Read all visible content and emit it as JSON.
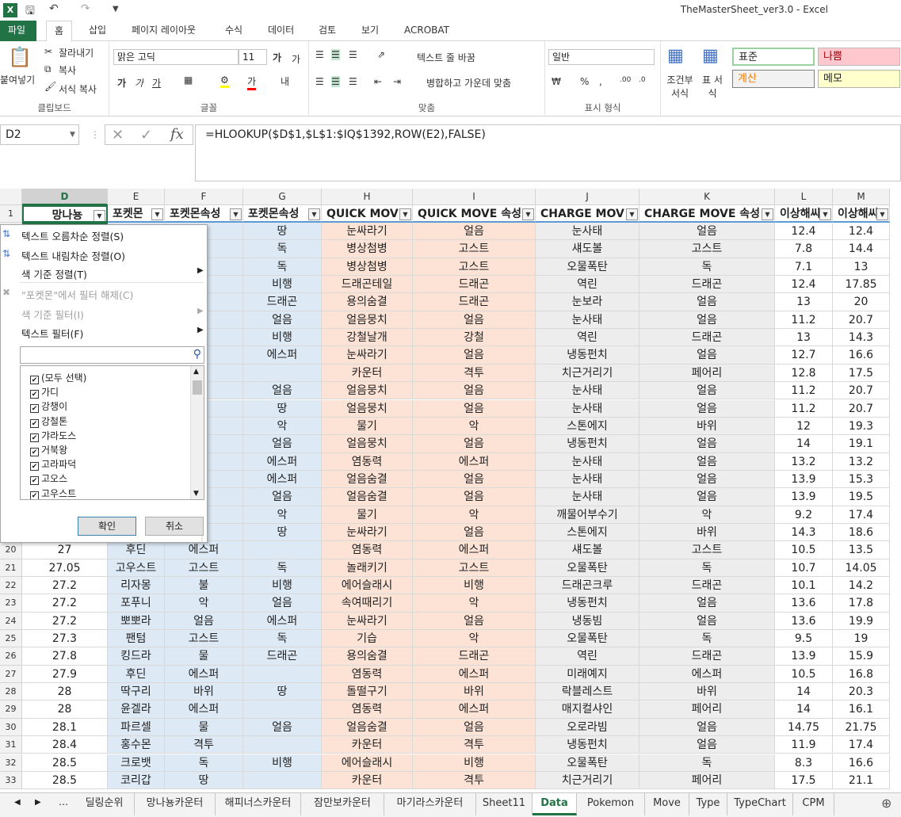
{
  "window": {
    "title": "TheMasterSheet_ver3.0 - Excel",
    "logo": "X"
  },
  "ribbon_tabs": [
    "파일",
    "홈",
    "삽입",
    "페이지 레이아웃",
    "수식",
    "데이터",
    "검토",
    "보기",
    "ACROBAT"
  ],
  "ribbon": {
    "clipboard": {
      "paste": "붙여넣기",
      "cut": "잘라내기",
      "copy": "복사",
      "format_painter": "서식 복사",
      "label": "클립보드"
    },
    "font": {
      "family": "맑은 고딕",
      "size": "11",
      "label": "글꼴"
    },
    "alignment": {
      "wrap": "텍스트 줄 바꿈",
      "merge": "병합하고 가운데 맞춤",
      "label": "맞춤"
    },
    "number": {
      "format": "일반",
      "label": "표시 형식"
    },
    "styles": {
      "cond_format": "조건부 서식",
      "table_format": "표 서식",
      "normal": "표준",
      "bad": "나쁨",
      "calc": "계산",
      "memo": "메모"
    }
  },
  "formula_bar": {
    "name_box": "D2",
    "formula": "=HLOOKUP($D$1,$L$1:$IQ$1392,ROW(E2),FALSE)"
  },
  "columns": [
    {
      "letter": "D",
      "header": "망나뇽",
      "w": 108
    },
    {
      "letter": "E",
      "header": "포켓몬",
      "w": 72
    },
    {
      "letter": "F",
      "header": "포켓몬속성",
      "w": 99
    },
    {
      "letter": "G",
      "header": "포켓몬속성",
      "w": 99
    },
    {
      "letter": "H",
      "header": "QUICK MOV",
      "w": 115
    },
    {
      "letter": "I",
      "header": "QUICK MOVE 속성",
      "w": 155
    },
    {
      "letter": "J",
      "header": "CHARGE MOV",
      "w": 131
    },
    {
      "letter": "K",
      "header": "CHARGE MOVE 속성",
      "w": 171
    },
    {
      "letter": "L",
      "header": "이상해씨",
      "w": 73
    },
    {
      "letter": "M",
      "header": "이상해씨",
      "w": 72
    }
  ],
  "rows": [
    {
      "n": "2",
      "cells": [
        "",
        "",
        "",
        "땅",
        "눈싸라기",
        "얼음",
        "눈사태",
        "얼음",
        "12.4",
        "12.4"
      ]
    },
    {
      "n": "3",
      "cells": [
        "",
        "",
        "",
        "독",
        "병상첨병",
        "고스트",
        "섀도볼",
        "고스트",
        "7.8",
        "14.4"
      ]
    },
    {
      "n": "4",
      "cells": [
        "",
        "",
        "",
        "독",
        "병상첨병",
        "고스트",
        "오물폭탄",
        "독",
        "7.1",
        "13"
      ]
    },
    {
      "n": "5",
      "cells": [
        "",
        "",
        "",
        "비행",
        "드래곤테일",
        "드래곤",
        "역린",
        "드래곤",
        "12.4",
        "17.85"
      ]
    },
    {
      "n": "6",
      "cells": [
        "",
        "",
        "",
        "드래곤",
        "용의숨결",
        "드래곤",
        "눈보라",
        "얼음",
        "13",
        "20"
      ]
    },
    {
      "n": "7",
      "cells": [
        "",
        "",
        "",
        "얼음",
        "얼음뭉치",
        "얼음",
        "눈사태",
        "얼음",
        "11.2",
        "20.7"
      ]
    },
    {
      "n": "8",
      "cells": [
        "",
        "",
        "",
        "비행",
        "강철날개",
        "강철",
        "역린",
        "드래곤",
        "13",
        "14.3"
      ]
    },
    {
      "n": "9",
      "cells": [
        "",
        "",
        "",
        "에스퍼",
        "눈싸라기",
        "얼음",
        "냉동펀치",
        "얼음",
        "12.7",
        "16.6"
      ]
    },
    {
      "n": "10",
      "cells": [
        "",
        "",
        "",
        "",
        "카운터",
        "격투",
        "치근거리기",
        "페어리",
        "12.8",
        "17.5"
      ]
    },
    {
      "n": "11",
      "cells": [
        "",
        "",
        "",
        "얼음",
        "얼음뭉치",
        "얼음",
        "눈사태",
        "얼음",
        "11.2",
        "20.7"
      ]
    },
    {
      "n": "12",
      "cells": [
        "",
        "",
        "",
        "땅",
        "얼음뭉치",
        "얼음",
        "눈사태",
        "얼음",
        "11.2",
        "20.7"
      ]
    },
    {
      "n": "13",
      "cells": [
        "",
        "",
        "",
        "악",
        "물기",
        "악",
        "스톤에지",
        "바위",
        "12",
        "19.3"
      ]
    },
    {
      "n": "14",
      "cells": [
        "",
        "",
        "",
        "얼음",
        "얼음뭉치",
        "얼음",
        "냉동펀치",
        "얼음",
        "14",
        "19.1"
      ]
    },
    {
      "n": "15",
      "cells": [
        "",
        "",
        "",
        "에스퍼",
        "염동력",
        "에스퍼",
        "눈사태",
        "얼음",
        "13.2",
        "13.2"
      ]
    },
    {
      "n": "16",
      "cells": [
        "",
        "",
        "",
        "에스퍼",
        "얼음숨결",
        "얼음",
        "눈사태",
        "얼음",
        "13.9",
        "15.3"
      ]
    },
    {
      "n": "17",
      "cells": [
        "",
        "",
        "",
        "얼음",
        "얼음숨결",
        "얼음",
        "눈사태",
        "얼음",
        "13.9",
        "19.5"
      ]
    },
    {
      "n": "18",
      "cells": [
        "",
        "",
        "",
        "악",
        "물기",
        "악",
        "깨물어부수기",
        "악",
        "9.2",
        "17.4"
      ]
    },
    {
      "n": "19",
      "cells": [
        "",
        "",
        "",
        "땅",
        "눈싸라기",
        "얼음",
        "스톤에지",
        "바위",
        "14.3",
        "18.6"
      ]
    },
    {
      "n": "20",
      "cells": [
        "27",
        "후딘",
        "에스퍼",
        "",
        "염동력",
        "에스퍼",
        "섀도볼",
        "고스트",
        "10.5",
        "13.5"
      ]
    },
    {
      "n": "21",
      "cells": [
        "27.05",
        "고우스트",
        "고스트",
        "독",
        "놀래키기",
        "고스트",
        "오물폭탄",
        "독",
        "10.7",
        "14.05"
      ]
    },
    {
      "n": "22",
      "cells": [
        "27.2",
        "리자몽",
        "불",
        "비행",
        "에어슬래시",
        "비행",
        "드래곤크루",
        "드래곤",
        "10.1",
        "14.2"
      ]
    },
    {
      "n": "23",
      "cells": [
        "27.2",
        "포푸니",
        "악",
        "얼음",
        "속여때리기",
        "악",
        "냉동펀치",
        "얼음",
        "13.6",
        "17.8"
      ]
    },
    {
      "n": "24",
      "cells": [
        "27.2",
        "뽀뽀라",
        "얼음",
        "에스퍼",
        "눈싸라기",
        "얼음",
        "냉동빔",
        "얼음",
        "13.6",
        "19.9"
      ]
    },
    {
      "n": "25",
      "cells": [
        "27.3",
        "팬텀",
        "고스트",
        "독",
        "기습",
        "악",
        "오물폭탄",
        "독",
        "9.5",
        "19"
      ]
    },
    {
      "n": "26",
      "cells": [
        "27.8",
        "킹드라",
        "물",
        "드래곤",
        "용의숨결",
        "드래곤",
        "역린",
        "드래곤",
        "13.9",
        "15.9"
      ]
    },
    {
      "n": "27",
      "cells": [
        "27.9",
        "후딘",
        "에스퍼",
        "",
        "염동력",
        "에스퍼",
        "미래예지",
        "에스퍼",
        "10.5",
        "16.8"
      ]
    },
    {
      "n": "28",
      "cells": [
        "28",
        "딱구리",
        "바위",
        "땅",
        "돌떨구기",
        "바위",
        "락블레스트",
        "바위",
        "14",
        "20.3"
      ]
    },
    {
      "n": "29",
      "cells": [
        "28",
        "윤겔라",
        "에스퍼",
        "",
        "염동력",
        "에스퍼",
        "매지컬샤인",
        "페어리",
        "14",
        "16.1"
      ]
    },
    {
      "n": "30",
      "cells": [
        "28.1",
        "파르셀",
        "물",
        "얼음",
        "얼음숨결",
        "얼음",
        "오로라빔",
        "얼음",
        "14.75",
        "21.75"
      ]
    },
    {
      "n": "31",
      "cells": [
        "28.4",
        "홍수몬",
        "격투",
        "",
        "카운터",
        "격투",
        "냉동펀치",
        "얼음",
        "11.9",
        "17.4"
      ]
    },
    {
      "n": "32",
      "cells": [
        "28.5",
        "크로뱃",
        "독",
        "비행",
        "에어슬래시",
        "비행",
        "오물폭탄",
        "독",
        "8.3",
        "16.6"
      ]
    },
    {
      "n": "33",
      "cells": [
        "28.5",
        "코리갑",
        "땅",
        "",
        "카운터",
        "격투",
        "치근거리기",
        "페어리",
        "17.5",
        "21.1"
      ]
    }
  ],
  "peek_cells": {
    "2": "음",
    "3": "트",
    "4": "트",
    "5": "곤",
    "8": "곤",
    "9": "음",
    "10": "발",
    "12": "음",
    "13": "퀴",
    "15": "음",
    "16": "음",
    "18": "퀴",
    "19": "음"
  },
  "filter_menu": {
    "sort_asc": "텍스트 오름차순 정렬(S)",
    "sort_desc": "텍스트 내림차순 정렬(O)",
    "sort_color": "색 기준 정렬(T)",
    "clear_filter": "\"포켓몬\"에서 필터 해제(C)",
    "filter_color": "색 기준 필터(I)",
    "text_filter": "텍스트 필터(F)",
    "items": [
      "(모두 선택)",
      "가디",
      "강챙이",
      "강철톤",
      "갸라도스",
      "거북왕",
      "고라파덕",
      "고오스",
      "고우스트"
    ],
    "ok": "확인",
    "cancel": "취소"
  },
  "sheet_tabs": [
    "딜링순위",
    "망나뇽카운터",
    "해피너스카운터",
    "잠만보카운터",
    "마기라스카운터",
    "Sheet11",
    "Data",
    "Pokemon",
    "Move",
    "Type",
    "TypeChart",
    "CPM"
  ],
  "active_sheet": "Data",
  "colors": {
    "excel_green": "#217346",
    "blue_fill": "#dde9f5",
    "peach_fill": "#fce3d6",
    "gray_fill": "#ededed"
  }
}
